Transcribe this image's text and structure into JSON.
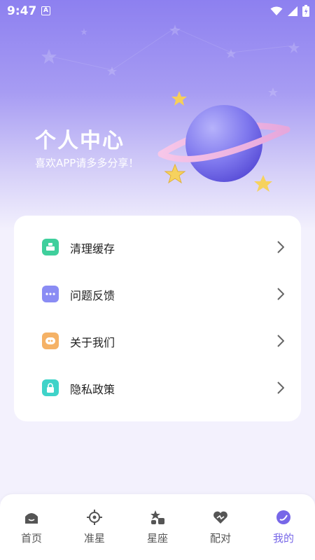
{
  "status_bar": {
    "time": "9:47",
    "badge": "A"
  },
  "hero": {
    "title": "个人中心",
    "subtitle": "喜欢APP请多多分享！"
  },
  "menu": [
    {
      "label": "清理缓存",
      "icon": "broom-icon",
      "color": "#3fcf9c"
    },
    {
      "label": "问题反馈",
      "icon": "message-icon",
      "color": "#8a8cf4"
    },
    {
      "label": "关于我们",
      "icon": "info-icon",
      "color": "#f5b266"
    },
    {
      "label": "隐私政策",
      "icon": "lock-icon",
      "color": "#3fd3c9"
    }
  ],
  "tabs": [
    {
      "label": "首页",
      "icon": "home-icon"
    },
    {
      "label": "准星",
      "icon": "crosshair-icon"
    },
    {
      "label": "星座",
      "icon": "constellation-icon"
    },
    {
      "label": "配对",
      "icon": "heart-icon"
    },
    {
      "label": "我的",
      "icon": "profile-icon",
      "active": true
    }
  ],
  "colors": {
    "accent": "#7767e8",
    "hero_top": "#8d80f0",
    "background": "#f3f1fd"
  }
}
